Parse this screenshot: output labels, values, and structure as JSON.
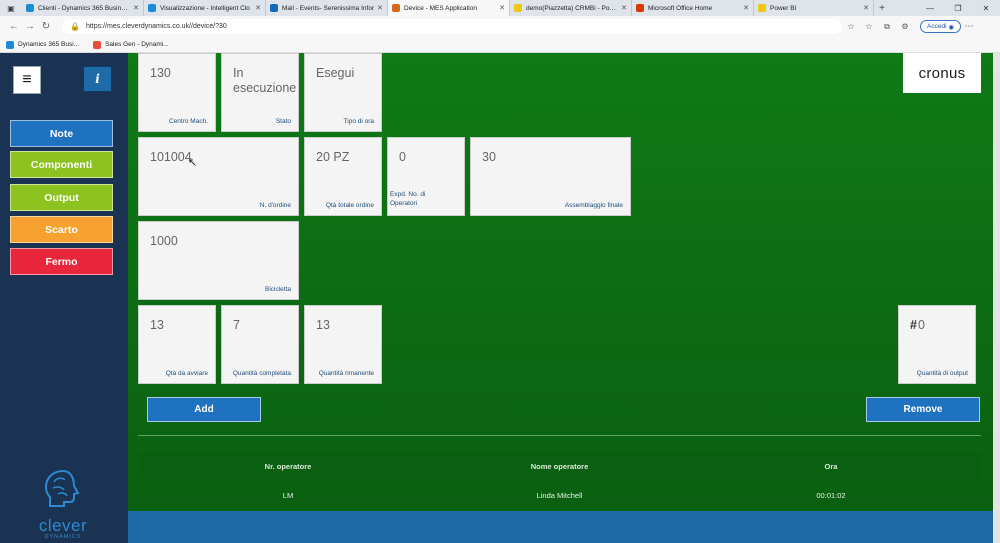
{
  "browser": {
    "tabs": [
      {
        "title": "Clienti - Dynamics 365 Business",
        "color": "#1c8cd8",
        "active": false
      },
      {
        "title": "Visualizzazione - Intelligent Clo",
        "color": "#1c8cd8",
        "active": false
      },
      {
        "title": "Mail - Events- Serenissima Infor",
        "color": "#0f6cbd",
        "active": false
      },
      {
        "title": "Device - MES Application",
        "color": "#d2691e",
        "active": true
      },
      {
        "title": "demo(Piazzetta) CRMBi - Power",
        "color": "#f2c811",
        "active": false
      },
      {
        "title": "Microsoft Office Home",
        "color": "#d83b01",
        "active": false
      },
      {
        "title": "Power BI",
        "color": "#f2c811",
        "active": false
      }
    ],
    "url": "https://mes.cleverdynamics.co.uk//device/?30",
    "signin_label": "Accedi",
    "favorites": [
      {
        "label": "Dynamics 365 Busi...",
        "color": "#1c8cd8"
      },
      {
        "label": "Sales Gen - Dynami...",
        "color": "#e74c3c"
      }
    ]
  },
  "sidebar": {
    "menu_icon": "hamburger-icon",
    "info_label": "i",
    "buttons": [
      {
        "label": "Note",
        "color": "#1f72bf"
      },
      {
        "label": "Componenti",
        "color": "#8cc31e"
      },
      {
        "label": "Output",
        "color": "#8cc31e"
      },
      {
        "label": "Scarto",
        "color": "#f7a230"
      },
      {
        "label": "Fermo",
        "color": "#e8263c"
      }
    ],
    "logo": {
      "name": "clever",
      "sub": "DYNAMICS"
    }
  },
  "brand": "cronus",
  "cards": {
    "centro": {
      "value": "130",
      "label": "Centro Mach."
    },
    "stato": {
      "value": "In esecuzione",
      "label": "Stato"
    },
    "tipo_ora": {
      "value": "Esegui",
      "label": "Tipo di ora"
    },
    "ordine": {
      "value": "101004",
      "label": "N. d'ordine"
    },
    "qta_totale": {
      "value": "20 PZ",
      "label": "Qtà totale ordine"
    },
    "operatori": {
      "value": "0",
      "label": "Expd. No. di Operatori"
    },
    "assemblaggio": {
      "value": "30",
      "label": "Assemblaggio finale"
    },
    "bicicletta": {
      "value": "1000",
      "label": "Bicicletta"
    },
    "qta_avviare": {
      "value": "13",
      "label": "Qtà da avviare"
    },
    "qta_completata": {
      "value": "7",
      "label": "Quantità completata"
    },
    "qta_rimanente": {
      "value": "13",
      "label": "Quantità rimanente"
    },
    "qta_output": {
      "prefix": "#",
      "value": "0",
      "label": "Quantità di output"
    }
  },
  "actions": {
    "add": "Add",
    "remove": "Remove"
  },
  "table": {
    "headers": [
      "Nr. operatore",
      "Nome operatore",
      "Ora"
    ],
    "rows": [
      [
        "LM",
        "Linda Mitchell",
        "00:01:02"
      ]
    ]
  }
}
